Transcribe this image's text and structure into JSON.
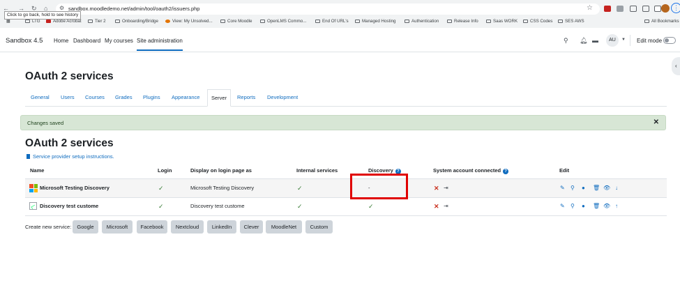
{
  "browser": {
    "url": "sandbox.moodledemo.net/admin/tool/oauth2/issuers.php",
    "tooltip": "Click to go back, hold to see history",
    "bookmarks": [
      "LTG",
      "Adobe Acrobat",
      "Tier 2",
      "Onboarding/Bridge",
      "View: My Unsolved...",
      "Core Moodle",
      "OpenLMS Commo...",
      "End Of URL's",
      "Managed Hosting",
      "Authentication",
      "Release Info",
      "Saas WORK",
      "CSS Codes",
      "SES AWS",
      "All Bookmarks"
    ]
  },
  "nav": {
    "site_name": "Sandbox 4.5",
    "links": [
      "Home",
      "Dashboard",
      "My courses",
      "Site administration"
    ],
    "avatar_initials": "AU",
    "edit_mode_label": "Edit mode",
    "edit_mode_on": false
  },
  "page_title": "OAuth 2 services",
  "tabs": [
    "General",
    "Users",
    "Courses",
    "Grades",
    "Plugins",
    "Appearance",
    "Server",
    "Reports",
    "Development"
  ],
  "active_tab": "Server",
  "alert": {
    "message": "Changes saved",
    "close_glyph": "✕"
  },
  "section_title": "OAuth 2 services",
  "help_link": "Service provider setup instructions.",
  "table": {
    "headers": {
      "name": "Name",
      "login": "Login",
      "display": "Display on login page as",
      "internal": "Internal services",
      "discovery": "Discovery",
      "system_account": "System account connected",
      "edit": "Edit"
    },
    "rows": [
      {
        "name": "Microsoft Testing Discovery",
        "login": "✓",
        "display": "Microsoft Testing Discovery",
        "internal": "✓",
        "discovery": "-",
        "system_account": "✕",
        "edit_icons": [
          "✎",
          "⚲",
          "●",
          "🗑",
          "👁",
          "↓"
        ]
      },
      {
        "name": "Discovery test custome",
        "login": "✓",
        "display": "Discovery test custome",
        "internal": "✓",
        "discovery": "✓",
        "system_account": "✕",
        "edit_icons": [
          "✎",
          "⚲",
          "●",
          "🗑",
          "👁",
          "↑"
        ]
      }
    ]
  },
  "create": {
    "label": "Create new service:",
    "buttons": [
      "Google",
      "Microsoft",
      "Facebook",
      "Nextcloud",
      "LinkedIn",
      "Clever",
      "MoodleNet",
      "Custom"
    ]
  },
  "colors": {
    "link": "#0f6cbf",
    "alert_bg": "#d7e6d5",
    "highlight": "#e00000",
    "check": "#357a32",
    "cross": "#ca3120"
  }
}
